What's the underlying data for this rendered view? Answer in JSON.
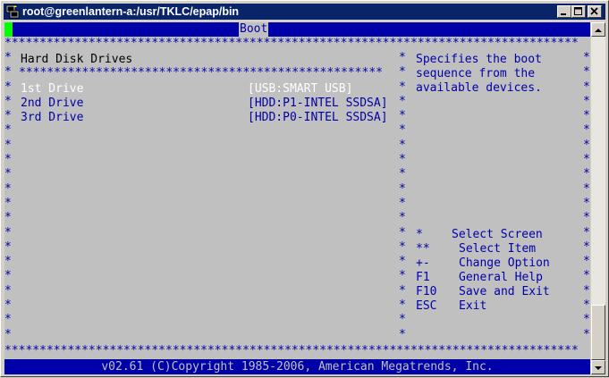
{
  "window": {
    "title": "root@greenlantern-a:/usr/TKLC/epap/bin",
    "icons": [
      "putty-icon",
      "minimize-icon",
      "maximize-icon",
      "close-icon"
    ]
  },
  "bios": {
    "menu_tab": "Boot",
    "section_title": "Hard Disk Drives",
    "drives": [
      {
        "name": "1st Drive",
        "value": "[USB:SMART USB]"
      },
      {
        "name": "2nd Drive",
        "value": "[HDD:P1-INTEL SSDSA]"
      },
      {
        "name": "3rd Drive",
        "value": "[HDD:P0-INTEL SSDSA]"
      }
    ],
    "help_lines": [
      "Specifies the boot",
      "sequence from the",
      "available devices."
    ],
    "keys": [
      {
        "key": "*",
        "action": "Select Screen"
      },
      {
        "key": "**",
        "action": "Select Item"
      },
      {
        "key": "+-",
        "action": "Change Option"
      },
      {
        "key": "F1",
        "action": "General Help"
      },
      {
        "key": "F10",
        "action": "Save and Exit"
      },
      {
        "key": "ESC",
        "action": "Exit"
      }
    ],
    "copyright": "v02.61 (C)Copyright 1985-2006, American Megatrends, Inc."
  },
  "colors": {
    "title_bar": "#0a246a",
    "bios_blue": "#0000a8",
    "bios_gray": "#c0c0c0",
    "cursor_green": "#00ff00"
  }
}
